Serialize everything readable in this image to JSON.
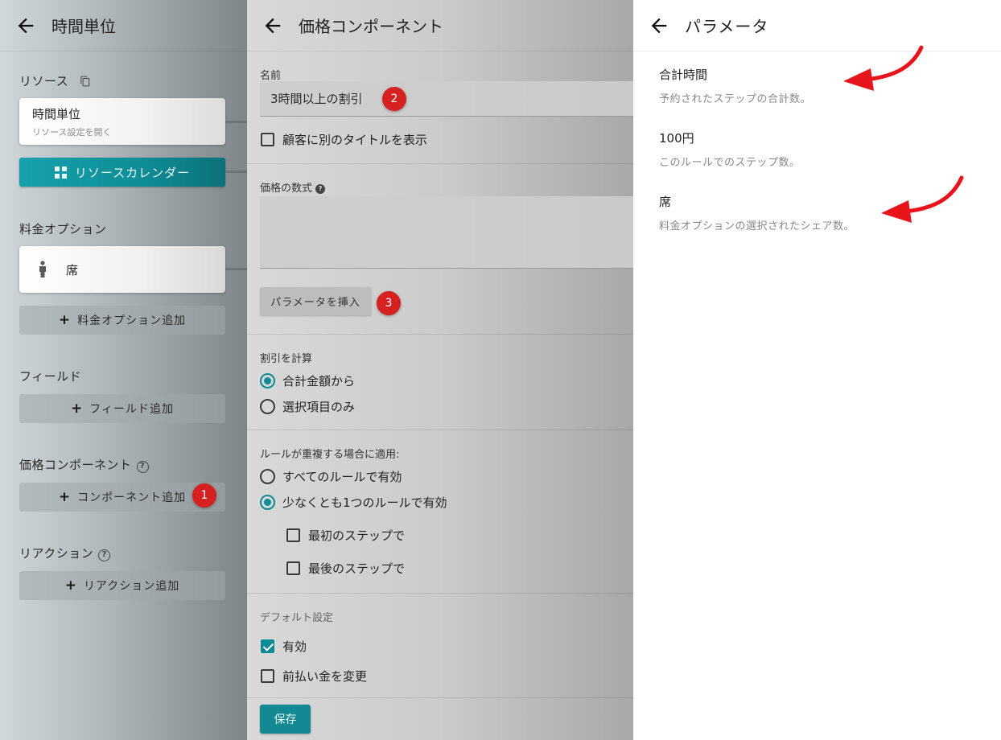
{
  "left": {
    "title": "時間単位",
    "resource_label": "リソース",
    "resource_card": {
      "title": "時間単位",
      "subtitle": "リソース設定を開く"
    },
    "calendar_button": "リソースカレンダー",
    "pricing_options_label": "料金オプション",
    "seat_card": "席",
    "add_pricing_option": "料金オプション追加",
    "fields_label": "フィールド",
    "add_field": "フィールド追加",
    "price_components_label": "価格コンポーネント",
    "add_component": "コンポーネント追加",
    "reactions_label": "リアクション",
    "add_reaction": "リアクション追加",
    "badge_1": "1"
  },
  "middle": {
    "title": "価格コンポーネント",
    "name_label": "名前",
    "name_value": "3時間以上の割引",
    "badge_2": "2",
    "alt_title_checkbox": "顧客に別のタイトルを表示",
    "formula_label": "価格の数式",
    "insert_param_button": "パラメータを挿入",
    "badge_3": "3",
    "discount_label": "割引を計算",
    "discount_options": [
      "合計金額から",
      "選択項目のみ"
    ],
    "overlap_label": "ルールが重複する場合に適用:",
    "overlap_options": [
      "すべてのルールで有効",
      "少なくとも1つのルールで有効"
    ],
    "step_first": "最初のステップで",
    "step_last": "最後のステップで",
    "defaults_label": "デフォルト設定",
    "enabled_checkbox": "有効",
    "prepay_checkbox": "前払い金を変更",
    "save_button": "保存"
  },
  "right": {
    "title": "パラメータ",
    "params": [
      {
        "name": "合計時間",
        "desc": "予約されたステップの合計数。"
      },
      {
        "name": "100円",
        "desc": "このルールでのステップ数。"
      },
      {
        "name": "席",
        "desc": "料金オプションの選択されたシェア数。"
      }
    ]
  },
  "colors": {
    "accent": "#0e8a94",
    "badge": "#d62121",
    "arrow": "#e8141b"
  }
}
